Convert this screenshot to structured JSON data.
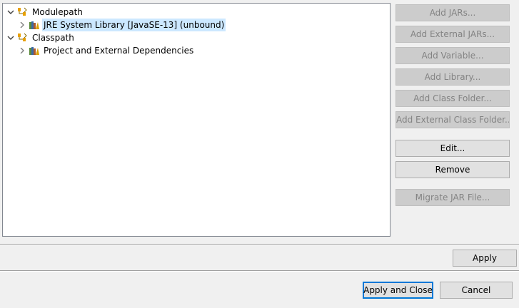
{
  "tree": {
    "items": [
      {
        "label": "Modulepath",
        "expanded": true,
        "icon": "library-group-icon"
      },
      {
        "label": "JRE System Library [JavaSE-13] (unbound)",
        "collapsed": true,
        "icon": "jre-library-icon"
      },
      {
        "label": "Classpath",
        "expanded": true,
        "icon": "library-group-icon"
      },
      {
        "label": "Project and External Dependencies",
        "collapsed": true,
        "icon": "jre-library-icon"
      }
    ]
  },
  "buttons": {
    "add_jars": "Add JARs...",
    "add_external_jars": "Add External JARs...",
    "add_variable": "Add Variable...",
    "add_library": "Add Library...",
    "add_class_folder": "Add Class Folder...",
    "add_external_class_folder": "Add External Class Folder...",
    "edit": "Edit...",
    "remove": "Remove",
    "migrate_jar_file": "Migrate JAR File...",
    "apply": "Apply",
    "apply_and_close": "Apply and Close",
    "cancel": "Cancel"
  },
  "colors": {
    "selection": "#cce8ff",
    "default_button_border": "#0078d7"
  }
}
